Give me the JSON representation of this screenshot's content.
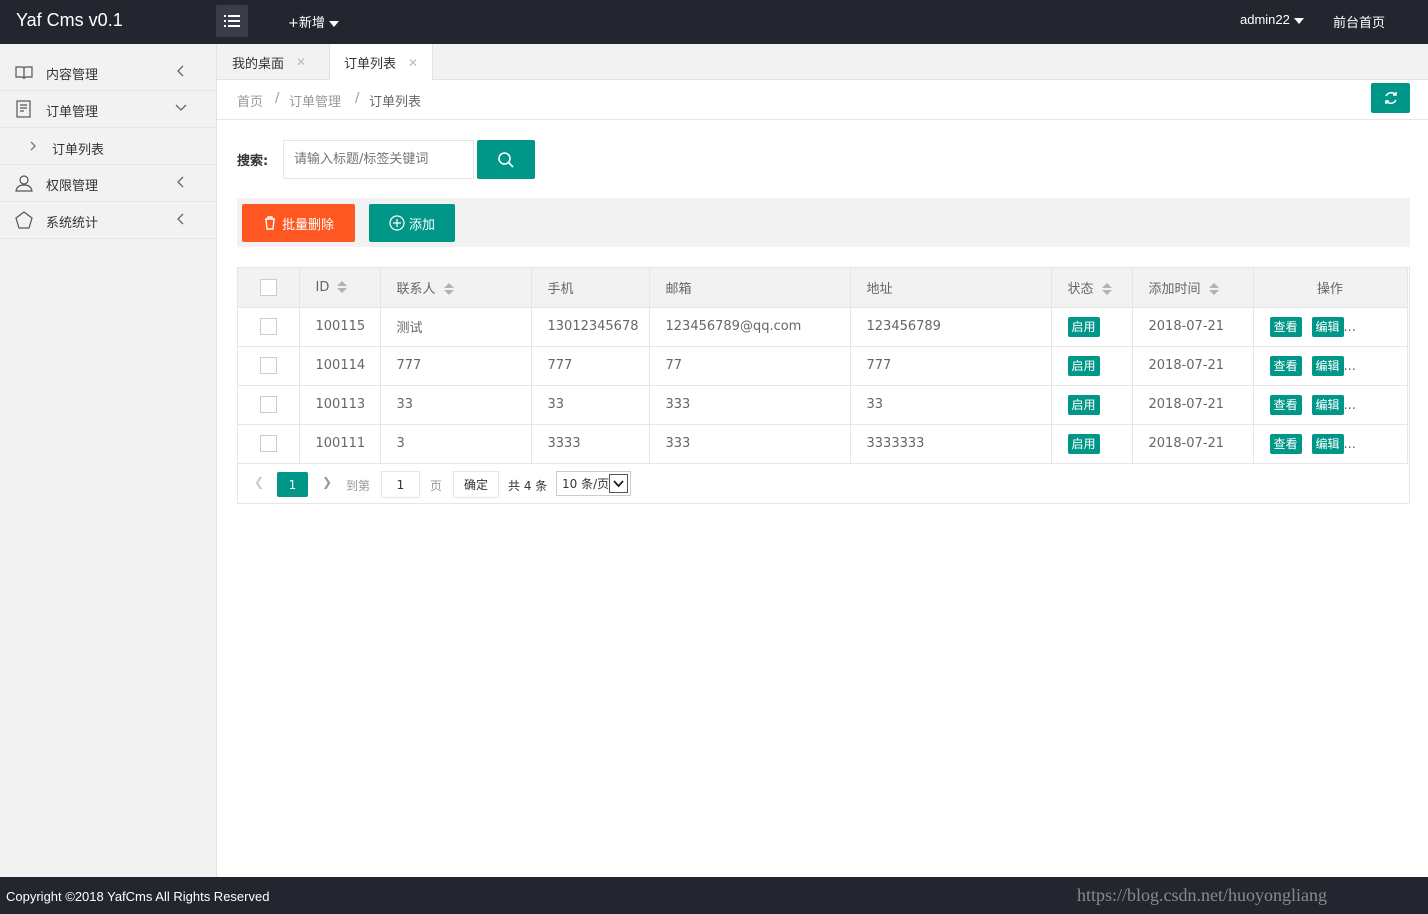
{
  "header": {
    "logo": "Yaf Cms v0.1",
    "new_label": "+新增",
    "user": "admin22",
    "front_link": "前台首页"
  },
  "sidebar": {
    "items": [
      {
        "label": "内容管理",
        "icon": "book-icon"
      },
      {
        "label": "订单管理",
        "icon": "form-icon"
      },
      {
        "label": "订单列表"
      },
      {
        "label": "权限管理",
        "icon": "user-icon"
      },
      {
        "label": "系统统计",
        "icon": "chart-icon"
      }
    ]
  },
  "tabs": [
    {
      "label": "我的桌面"
    },
    {
      "label": "订单列表"
    }
  ],
  "breadcrumb": [
    "首页",
    "订单管理",
    "订单列表"
  ],
  "search": {
    "label": "搜索:",
    "placeholder": "请输入标题/标签关键词"
  },
  "toolbar": {
    "delete_label": "批量删除",
    "add_label": "添加"
  },
  "table": {
    "headers": [
      "ID",
      "联系人",
      "手机",
      "邮箱",
      "地址",
      "状态",
      "添加时间",
      "操作"
    ],
    "rows": [
      {
        "id": "100115",
        "contact": "测试",
        "phone": "13012345678",
        "email": "123456789@qq.com",
        "address": "123456789",
        "status": "启用",
        "date": "2018-07-21"
      },
      {
        "id": "100114",
        "contact": "777",
        "phone": "777",
        "email": "77",
        "address": "777",
        "status": "启用",
        "date": "2018-07-21"
      },
      {
        "id": "100113",
        "contact": "33",
        "phone": "33",
        "email": "333",
        "address": "33",
        "status": "启用",
        "date": "2018-07-21"
      },
      {
        "id": "100111",
        "contact": "3",
        "phone": "3333",
        "email": "333",
        "address": "3333333",
        "status": "启用",
        "date": "2018-07-21"
      }
    ],
    "view_label": "查看",
    "edit_label": "编辑",
    "more": "..."
  },
  "pager": {
    "current": "1",
    "goto_label": "到第",
    "goto_value": "1",
    "page_unit": "页",
    "ok_label": "确定",
    "total": "共 4 条",
    "page_size": "10 条/页"
  },
  "footer": {
    "copyright": "Copyright ©2018 YafCms All Rights Reserved",
    "watermark": "https://blog.csdn.net/huoyongliang"
  },
  "colors": {
    "header_bg": "#23262e",
    "accent": "#009688",
    "danger": "#ff5722"
  }
}
